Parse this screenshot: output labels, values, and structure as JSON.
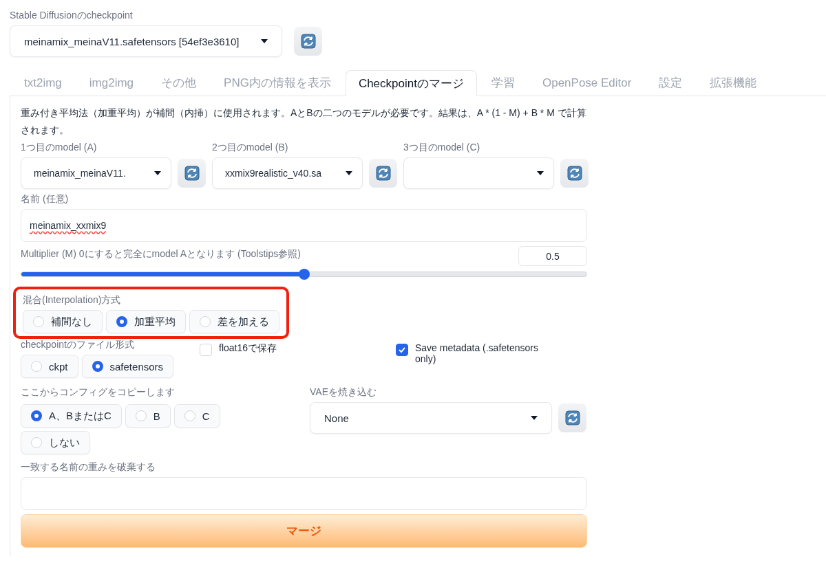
{
  "checkpoint": {
    "label": "Stable Diffusionのcheckpoint",
    "value": "meinamix_meinaV11.safetensors [54ef3e3610]"
  },
  "tabs": [
    {
      "label": "txt2img",
      "selected": false
    },
    {
      "label": "img2img",
      "selected": false
    },
    {
      "label": "その他",
      "selected": false
    },
    {
      "label": "PNG内の情報を表示",
      "selected": false
    },
    {
      "label": "Checkpointのマージ",
      "selected": true
    },
    {
      "label": "学習",
      "selected": false
    },
    {
      "label": "OpenPose Editor",
      "selected": false
    },
    {
      "label": "設定",
      "selected": false
    },
    {
      "label": "拡張機能",
      "selected": false
    }
  ],
  "merge_panel": {
    "description": "重み付き平均法（加重平均）が補間（内挿）に使用されます。AとBの二つのモデルが必要です。結果は、A * (1 - M) + B * M で計算されます。",
    "models": [
      {
        "label": "1つ目のmodel (A)",
        "value": "meinamix_meinaV11."
      },
      {
        "label": "2つ目のmodel (B)",
        "value": "xxmix9realistic_v40.sa"
      },
      {
        "label": "3つ目のmodel (C)"
      }
    ],
    "name_field": {
      "label": "名前 (任意)",
      "value": "meinamix_xxmix9",
      "misspelled": true
    },
    "multiplier": {
      "label": "Multiplier (M) 0にすると完全にmodel Aとなります (Toolstips参照)",
      "reading": "0.5",
      "level": 0.5
    },
    "interpolation": {
      "label": "混合(Interpolation)方式",
      "highlighted": true,
      "options": [
        {
          "label": "補間なし",
          "selected": false
        },
        {
          "label": "加重平均",
          "selected": true
        },
        {
          "label": "差を加える",
          "selected": false
        }
      ]
    },
    "file_format": {
      "label": "checkpointのファイル形式",
      "options": [
        {
          "label": "ckpt",
          "selected": false
        },
        {
          "label": "safetensors",
          "selected": true
        }
      ]
    },
    "float16": {
      "label": "float16で保存",
      "checked": false
    },
    "save_metadata": {
      "label": "Save metadata (.safetensors only)",
      "checked": true
    },
    "config_source": {
      "label": "ここからコンフィグをコピーします",
      "options": [
        {
          "label": "A、BまたはC",
          "selected": true
        },
        {
          "label": "B",
          "selected": false
        },
        {
          "label": "C",
          "selected": false
        },
        {
          "label": "しない",
          "selected": false
        }
      ]
    },
    "bake_vae": {
      "label": "VAEを焼き込む",
      "value": "None"
    },
    "discard_weights": {
      "label": "一致する名前の重みを破棄する"
    },
    "merge_button": "マージ"
  }
}
